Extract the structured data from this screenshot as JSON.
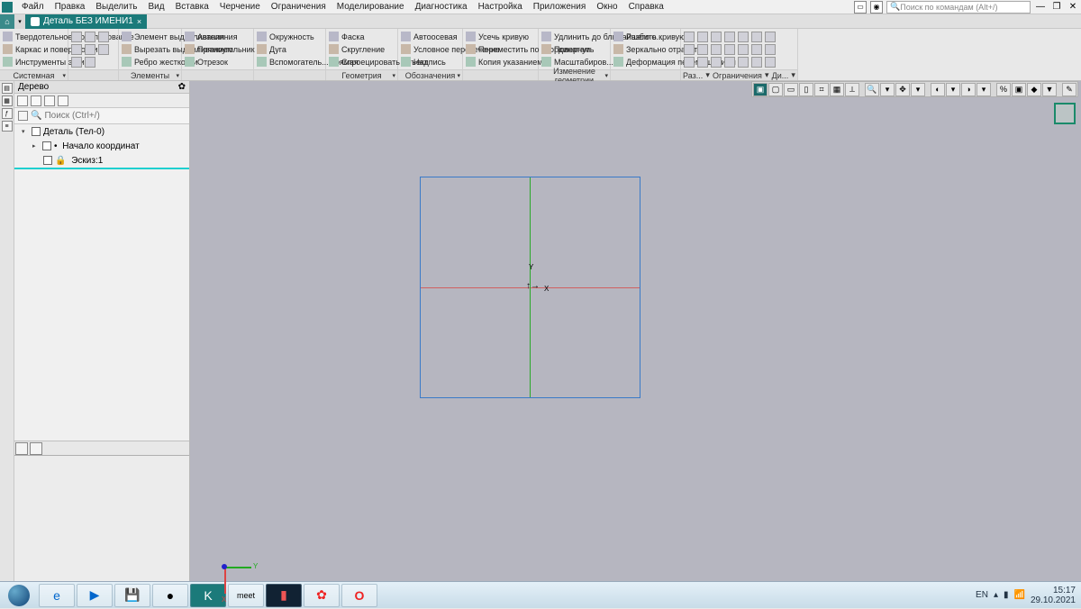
{
  "menu": [
    "Файл",
    "Правка",
    "Выделить",
    "Вид",
    "Вставка",
    "Черчение",
    "Ограничения",
    "Моделирование",
    "Диагностика",
    "Настройка",
    "Приложения",
    "Окно",
    "Справка"
  ],
  "topSearchPlaceholder": "Поиск по командам (Alt+/)",
  "docTab": "Деталь БЕЗ ИМЕНИ1",
  "ribbon": {
    "c1": {
      "rows": [
        "Твердотельное моделирование",
        "Каркас и поверхности",
        "Инструменты эскиза"
      ],
      "footer": "Системная"
    },
    "c3": {
      "rows": [
        "Элемент выдавливания",
        "Вырезать выдавливанием",
        "Ребро жесткости"
      ],
      "footer": "Элементы"
    },
    "c4": {
      "rows": [
        "Автолиния",
        "Прямоугольник",
        "Отрезок"
      ]
    },
    "c5": {
      "rows": [
        "Окружность",
        "Дуга",
        "Вспомогатель... прямая"
      ]
    },
    "c6": {
      "rows": [
        "Фаска",
        "Скругление",
        "Спроецировать объект"
      ],
      "footer": "Геометрия"
    },
    "c7": {
      "rows": [
        "Автоосевая",
        "Условное пересечение",
        "Надпись"
      ],
      "footer": "Обозначения"
    },
    "c8": {
      "rows": [
        "Усечь кривую",
        "Переместить по координатам",
        "Копия указанием"
      ]
    },
    "c9": {
      "rows": [
        "Удлинить до ближайшего о...",
        "Повернуть",
        "Масштабиров..."
      ],
      "footer": "Изменение геометрии"
    },
    "c10": {
      "rows": [
        "Разбить кривую",
        "Зеркально отразить",
        "Деформация перемещением"
      ]
    },
    "c11": {
      "footer": "Раз..."
    },
    "c12": {
      "footer": "Ограничения"
    },
    "c13": {
      "footer": "Ди..."
    }
  },
  "leftPanel": {
    "title": "Дерево",
    "searchPlaceholder": "Поиск (Ctrl+/)",
    "tree": {
      "root": "Деталь (Тел-0)",
      "n1": "Начало координат",
      "n2": "Эскиз:1"
    }
  },
  "canvas": {
    "xLabel": "X",
    "yLabel": "Y"
  },
  "tray": {
    "lang": "EN",
    "time": "15:17",
    "date": "29.10.2021"
  },
  "taskbarApps": [
    "e",
    "▶",
    "💾",
    "●",
    "K",
    "meet",
    "▮",
    "✿",
    "O"
  ]
}
